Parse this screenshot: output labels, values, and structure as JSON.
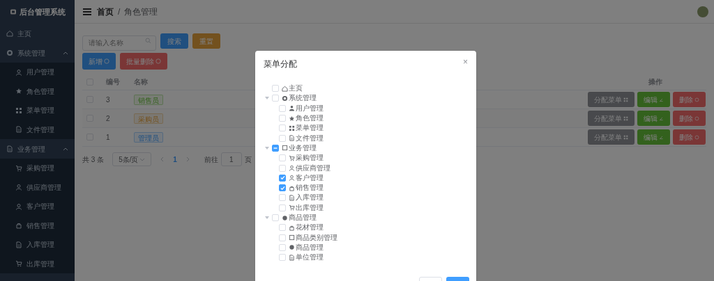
{
  "sidebar": {
    "title": "后台管理系统",
    "items": [
      {
        "label": "主页"
      },
      {
        "label": "系统管理",
        "expanded": true,
        "children": [
          {
            "label": "用户管理"
          },
          {
            "label": "角色管理"
          },
          {
            "label": "菜单管理"
          },
          {
            "label": "文件管理"
          }
        ]
      },
      {
        "label": "业务管理",
        "expanded": true,
        "children": [
          {
            "label": "采购管理"
          },
          {
            "label": "供应商管理"
          },
          {
            "label": "客户管理"
          },
          {
            "label": "销售管理"
          },
          {
            "label": "入库管理"
          },
          {
            "label": "出库管理"
          }
        ]
      }
    ]
  },
  "breadcrumb": [
    "首页",
    "/",
    "角色管理"
  ],
  "search": {
    "placeholder": "请输入名称"
  },
  "buttons": [
    {
      "label": "搜索",
      "kind": "primary"
    },
    {
      "label": "重置",
      "kind": "warning"
    }
  ],
  "actions": [
    {
      "label": "新增",
      "kind": "primary"
    },
    {
      "label": "批量删除",
      "kind": "danger"
    }
  ],
  "table": {
    "select_all_checked": false,
    "columns": [
      "编号",
      "名称",
      "操作"
    ],
    "rows": [
      {
        "checked": false,
        "id": "3",
        "name": "销售员",
        "kind": "success",
        "buttons": [
          "分配菜单",
          "编辑",
          "删除"
        ]
      },
      {
        "checked": false,
        "id": "2",
        "name": "采购员",
        "kind": "warning",
        "buttons": [
          "分配菜单",
          "编辑",
          "删除"
        ]
      },
      {
        "checked": false,
        "id": "1",
        "name": "管理员",
        "kind": "primary",
        "buttons": [
          "分配菜单",
          "编辑",
          "删除"
        ]
      }
    ]
  },
  "pagination": {
    "total": "共 3 条",
    "page_size": "5条/页",
    "current": "1",
    "goto_label": "前往",
    "goto_value": "1",
    "goto_suffix": "页"
  },
  "dialog": {
    "title": "菜单分配",
    "close": "×",
    "tree": [
      {
        "label": "主页",
        "checked": false,
        "indeterminate": false
      },
      {
        "label": "系统管理",
        "checked": false,
        "indeterminate": false,
        "expanded": true,
        "children": [
          {
            "label": "用户管理",
            "checked": false
          },
          {
            "label": "角色管理",
            "checked": false
          },
          {
            "label": "菜单管理",
            "checked": false
          },
          {
            "label": "文件管理",
            "checked": false
          }
        ]
      },
      {
        "label": "业务管理",
        "checked": false,
        "indeterminate": true,
        "expanded": true,
        "children": [
          {
            "label": "采购管理",
            "checked": false
          },
          {
            "label": "供应商管理",
            "checked": false
          },
          {
            "label": "客户管理",
            "checked": true
          },
          {
            "label": "销售管理",
            "checked": true
          },
          {
            "label": "入库管理",
            "checked": false
          },
          {
            "label": "出库管理",
            "checked": false
          }
        ]
      },
      {
        "label": "商品管理",
        "checked": false,
        "indeterminate": false,
        "expanded": true,
        "children": [
          {
            "label": "花材管理",
            "checked": false
          },
          {
            "label": "商品类别管理",
            "checked": false
          },
          {
            "label": "商品管理",
            "checked": false
          },
          {
            "label": "单位管理",
            "checked": false
          }
        ]
      }
    ]
  }
}
